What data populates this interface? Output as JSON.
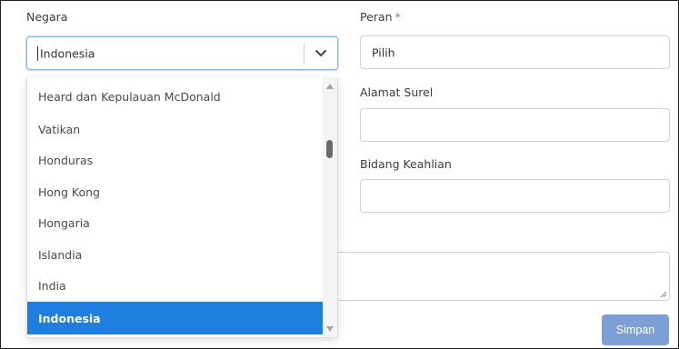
{
  "form": {
    "negara_label": "Negara",
    "negara_value": "Indonesia",
    "peran_label": "Peran",
    "peran_required_mark": "*",
    "peran_value": "Pilih",
    "alamat_surel_label": "Alamat Surel",
    "alamat_surel_value": "",
    "bidang_keahlian_label": "Bidang Keahlian",
    "bidang_keahlian_value": "",
    "save_label": "Simpan"
  },
  "dropdown": {
    "options": [
      "Heard dan Kepulauan McDonald",
      "Vatikan",
      "Honduras",
      "Hong Kong",
      "Hongaria",
      "Islandia",
      "India",
      "Indonesia"
    ],
    "selected": "Indonesia"
  },
  "colors": {
    "selected_bg": "#1e7fe0",
    "button_bg": "#7c9fd6",
    "required": "#e35d5d"
  },
  "icons": {
    "select_toggle": "chevron-down-icon",
    "scroll_up": "scroll-up-arrow-icon",
    "scroll_down": "scroll-down-arrow-icon",
    "resize": "resize-grip-icon"
  }
}
